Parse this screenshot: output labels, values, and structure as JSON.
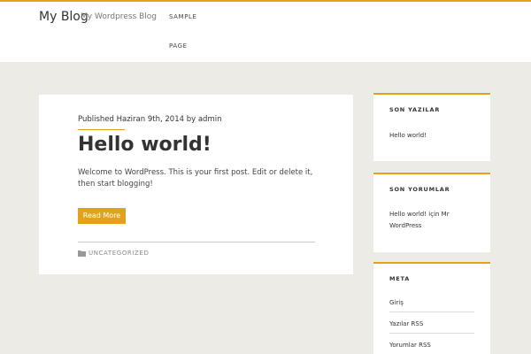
{
  "site": {
    "title": "My Blog",
    "description": "My Wordpress Blog"
  },
  "nav": {
    "items": [
      "SAMPLE",
      "PAGE"
    ]
  },
  "post": {
    "meta": "Published Haziran 9th, 2014 by admin",
    "title": "Hello world!",
    "excerpt": "Welcome to WordPress. This is your first post. Edit or delete it, then start blogging!",
    "read_more": "Read More",
    "category": "UNCATEGORIZED"
  },
  "sidebar": {
    "recent_posts": {
      "title": "SON YAZILAR",
      "items": [
        "Hello world!"
      ]
    },
    "recent_comments": {
      "title": "SON YORUMLAR",
      "items": [
        "Hello world! için Mr WordPress"
      ]
    },
    "meta": {
      "title": "META",
      "items": [
        "Giriş",
        "Yazılar RSS",
        "Yorumlar RSS"
      ]
    }
  },
  "colors": {
    "accent": "#e2a21c",
    "background": "#ecebe6"
  }
}
